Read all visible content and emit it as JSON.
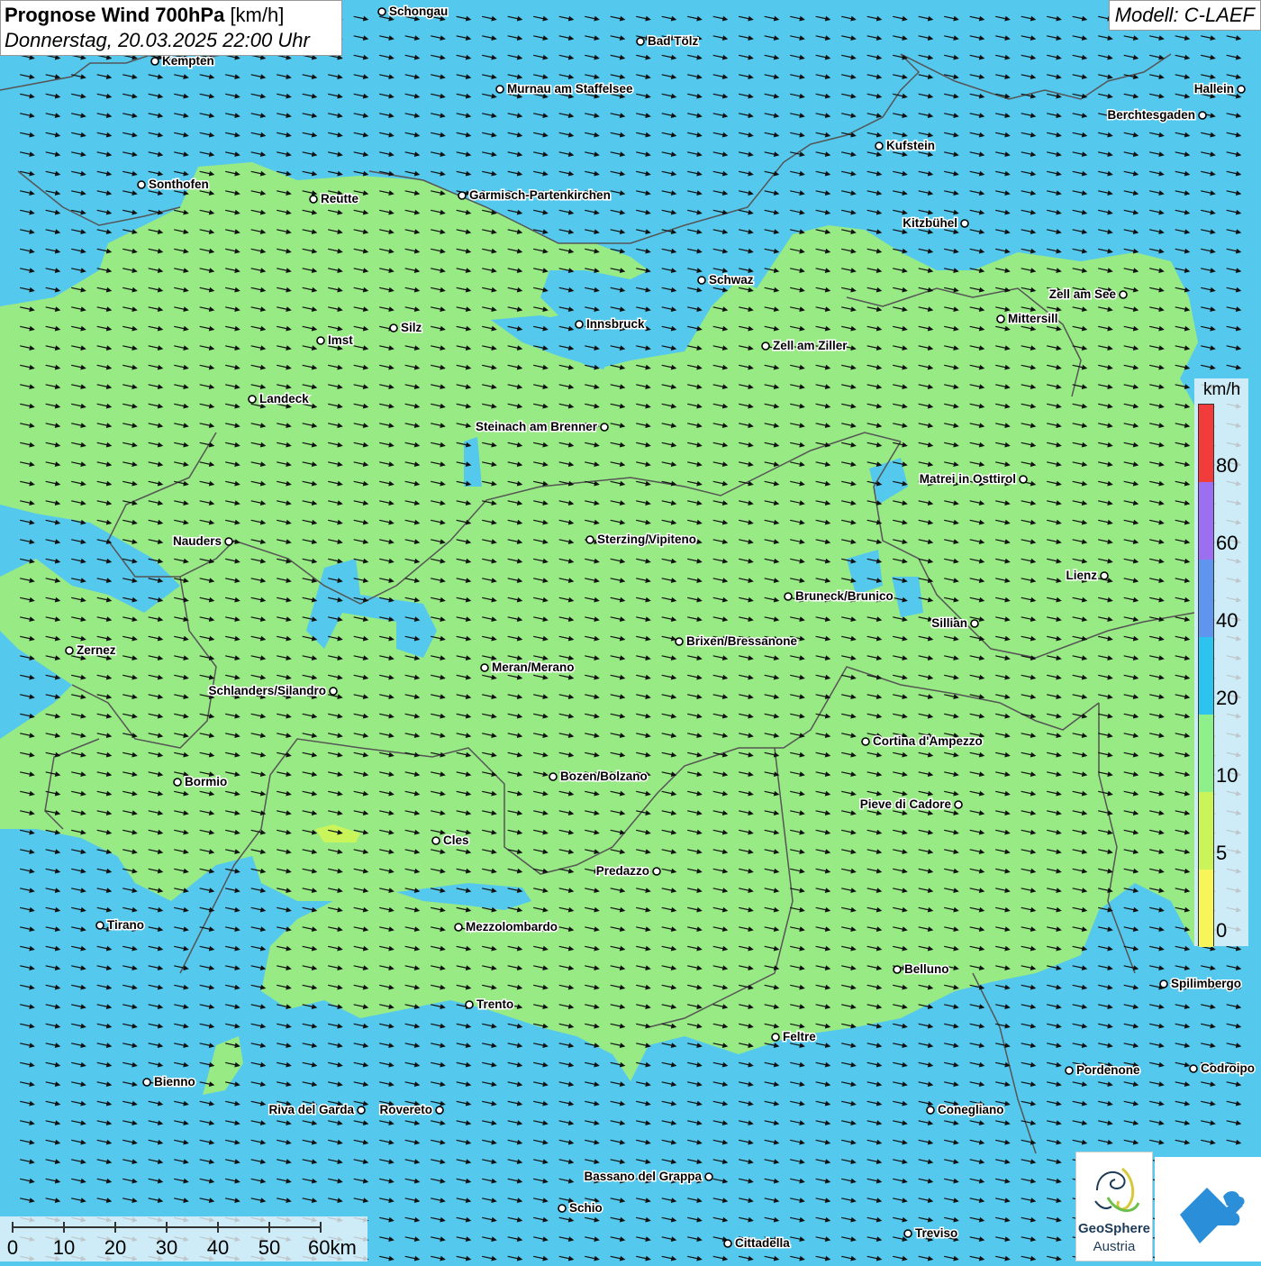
{
  "header": {
    "title_bold": "Prognose Wind 700hPa",
    "title_unit": "[km/h]",
    "subtitle": "Donnerstag, 20.03.2025 22:00 Uhr",
    "model": "Modell: C-LAEF"
  },
  "legend": {
    "unit": "km/h",
    "bands": [
      {
        "from": 0,
        "to": 5,
        "color": "#f6f65a"
      },
      {
        "from": 5,
        "to": 10,
        "color": "#c9f55a"
      },
      {
        "from": 10,
        "to": 20,
        "color": "#8ef08a"
      },
      {
        "from": 20,
        "to": 40,
        "color": "#2cc3ef"
      },
      {
        "from": 40,
        "to": 60,
        "color": "#5f95ee"
      },
      {
        "from": 60,
        "to": 80,
        "color": "#9b6ff0"
      },
      {
        "from": 80,
        "to": 100,
        "color": "#f23b3b"
      }
    ],
    "labels": [
      "0",
      "5",
      "10",
      "20",
      "40",
      "60",
      "80"
    ]
  },
  "scale": {
    "ticks": [
      "0",
      "10",
      "20",
      "30",
      "40",
      "50",
      "60km"
    ]
  },
  "logos": {
    "geosphere_line1": "GeoSphere",
    "geosphere_line2": "Austria"
  },
  "colors": {
    "sea_blue": "#55c8ee",
    "wind_green": "#98ea84",
    "border_gray": "#555555"
  },
  "wind": {
    "direction": "west-northwest flow, arrows pointing east-southeast"
  },
  "cities": [
    "Schongau",
    "Bad Tölz",
    "Kempten",
    "Murnau am Staffelsee",
    "Hallein",
    "Berchtesgaden",
    "Kufstein",
    "Sonthofen",
    "Reutte",
    "Garmisch-Partenkirchen",
    "Kitzbühel",
    "Schwaz",
    "Zell am See",
    "Mittersill",
    "Innsbruck",
    "Silz",
    "Imst",
    "Zell am Ziller",
    "Landeck",
    "Steinach am Brenner",
    "Matrei in Osttirol",
    "Nauders",
    "Sterzing/Vipiteno",
    "Lienz",
    "Bruneck/Brunico",
    "Sillian",
    "Zernez",
    "Brixen/Bressanone",
    "Meran/Merano",
    "Schlanders/Silandro",
    "Cortina d'Ampezzo",
    "Bormio",
    "Bozen/Bolzano",
    "Pieve di Cadore",
    "Cles",
    "Predazzo",
    "Tirano",
    "Mezzolombardo",
    "Belluno",
    "Spilimbergo",
    "Trento",
    "Feltre",
    "Pordenone",
    "Codroipo",
    "Bienno",
    "Riva del Garda",
    "Rovereto",
    "Conegliano",
    "Bassano del Grappa",
    "Schio",
    "Treviso",
    "Cittadella"
  ]
}
